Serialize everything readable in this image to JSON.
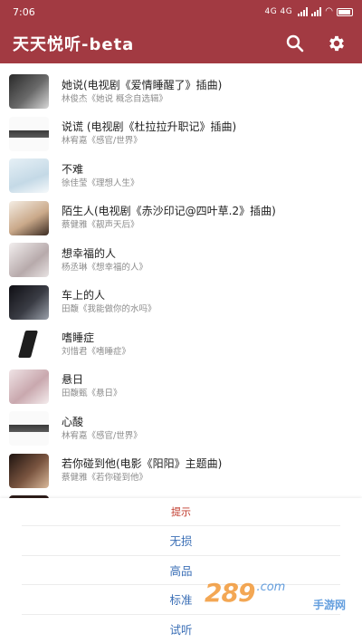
{
  "status": {
    "time": "7:06",
    "network": "4G 4G"
  },
  "appbar": {
    "title": "天天悦听-beta",
    "search_icon": "search-icon",
    "settings_icon": "gear-icon",
    "color": "#a23a42"
  },
  "songs": [
    {
      "title": "她说(电视剧《爱情睡醒了》插曲)",
      "subtitle": "林俊杰《她说 概念自选辑》"
    },
    {
      "title": "说谎 (电视剧《杜拉拉升职记》插曲)",
      "subtitle": "林宥嘉《感官/世界》"
    },
    {
      "title": "不难",
      "subtitle": "徐佳莹《理想人生》"
    },
    {
      "title": "陌生人(电视剧《赤沙印记@四叶草.2》插曲)",
      "subtitle": "蔡健雅《靓声天后》"
    },
    {
      "title": "想幸福的人",
      "subtitle": "杨丞琳《想幸福的人》"
    },
    {
      "title": "车上的人",
      "subtitle": "田馥《我能做你的水吗》"
    },
    {
      "title": "嗜睡症",
      "subtitle": "刘惜君《嗜睡症》"
    },
    {
      "title": "悬日",
      "subtitle": "田馥甄《悬日》"
    },
    {
      "title": "心酸",
      "subtitle": "林宥嘉《感官/世界》"
    },
    {
      "title": "若你碰到他(电影《阳阳》主题曲)",
      "subtitle": "蔡健雅《若你碰到他》"
    },
    {
      "title": "",
      "subtitle": ""
    }
  ],
  "dialog": {
    "title": "提示",
    "options": [
      "无损",
      "高品",
      "标准",
      "试听"
    ],
    "title_color": "#c0392b",
    "option_color": "#3b6fb6"
  },
  "watermark": {
    "logo": "289",
    "domain": ".com",
    "sub": "手游网"
  }
}
